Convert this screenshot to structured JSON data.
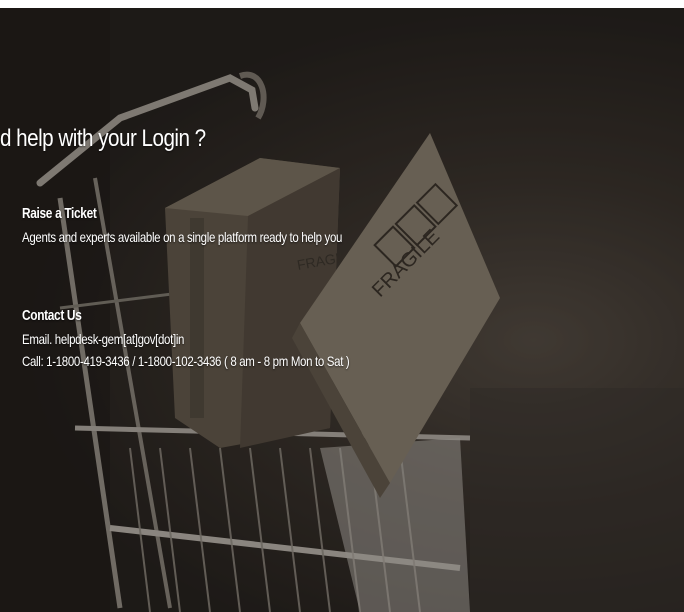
{
  "heading": "d help with your Login ?",
  "raise_ticket": {
    "title": "Raise a Ticket",
    "description": "Agents and experts available on a single platform ready to help you"
  },
  "contact": {
    "title": "Contact Us",
    "email": "Email. helpdesk-gem[at]gov[dot]in",
    "call": "Call: 1-1800-419-3436 / 1-1800-102-3436 ( 8 am - 8 pm Mon to Sat )"
  },
  "background": {
    "box_labels": [
      "FRAGILE",
      "FRAGILE"
    ],
    "colors": {
      "overlay": "#141210",
      "box": "#b8aa94",
      "cart": "#d6d0c8"
    }
  }
}
